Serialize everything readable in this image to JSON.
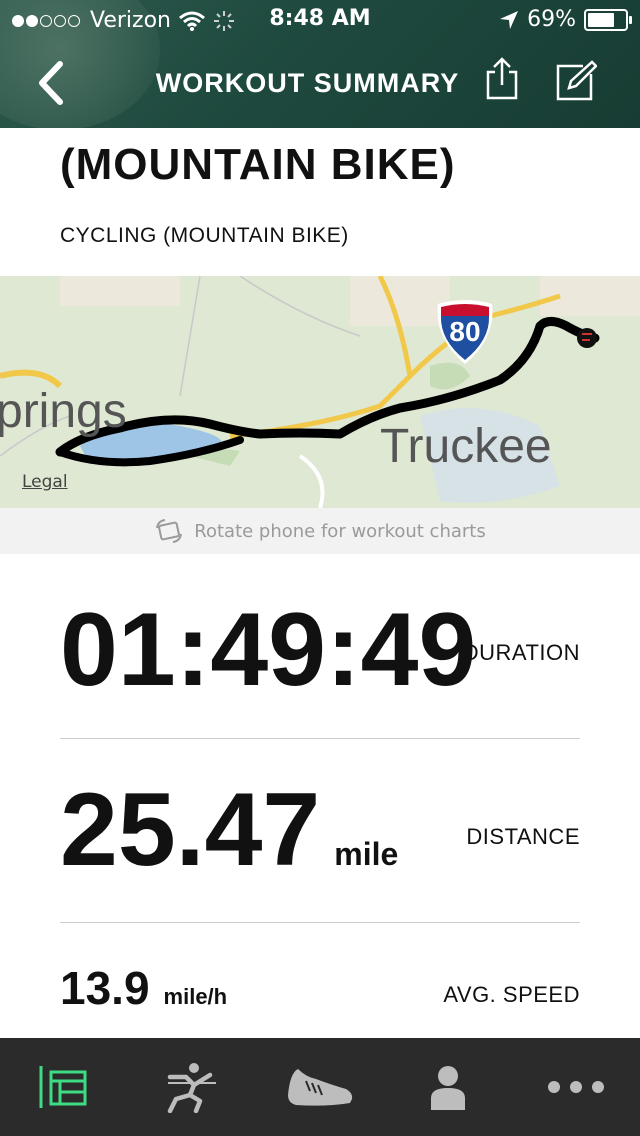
{
  "status_bar": {
    "carrier": "Verizon",
    "time": "8:48 AM",
    "battery": "69%",
    "battery_level": 0.69
  },
  "nav": {
    "title": "WORKOUT SUMMARY",
    "icons": [
      "back-chevron-icon",
      "share-icon",
      "edit-icon"
    ]
  },
  "workout": {
    "name": "(MOUNTAIN BIKE)",
    "activity_type": "CYCLING (MOUNTAIN BIKE)"
  },
  "map": {
    "labels": {
      "town_left": "prings",
      "town_right": "Truckee",
      "highway": "80"
    },
    "legal": "Legal",
    "colors": {
      "land": "#dfe8d2",
      "lake": "#9ec5e6",
      "route": "#000000",
      "road": "#f2c84b"
    }
  },
  "rotate_hint": "Rotate phone for workout charts",
  "stats": {
    "duration": {
      "value": "01:49:49",
      "label": "DURATION"
    },
    "distance": {
      "value": "25.47",
      "unit": "mile",
      "label": "DISTANCE"
    },
    "avg_speed": {
      "value": "13.9",
      "unit": "mile/h",
      "label": "AVG. SPEED"
    }
  },
  "tab_bar": {
    "active_color": "#3ddc84",
    "inactive_color": "#bdbdbd",
    "tabs": [
      "feed-icon",
      "runner-finish-icon",
      "shoe-icon",
      "profile-icon",
      "more-icon"
    ],
    "active_index": 0
  }
}
